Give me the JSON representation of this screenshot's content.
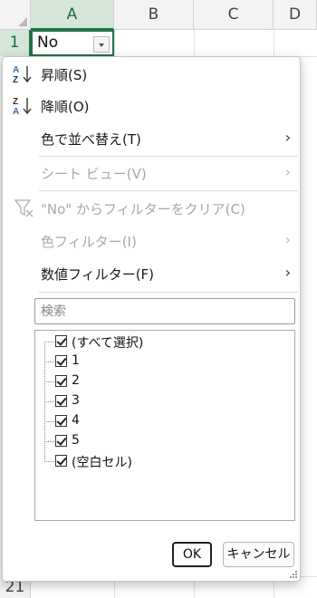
{
  "spreadsheet": {
    "columns": [
      "A",
      "B",
      "C",
      "D"
    ],
    "rows": [
      "1",
      "21"
    ],
    "cell_a1": "No"
  },
  "menu": {
    "sort_asc": "昇順(S)",
    "sort_desc": "降順(O)",
    "sort_by_color": "色で並べ替え(T)",
    "sheet_view": "シート ビュー(V)",
    "clear_filter": "\"No\" からフィルターをクリア(C)",
    "color_filter": "色フィルター(I)",
    "number_filter": "数値フィルター(F)",
    "search_placeholder": "検索",
    "list_items": [
      "(すべて選択)",
      "1",
      "2",
      "3",
      "4",
      "5",
      "(空白セル)"
    ],
    "ok_label": "OK",
    "cancel_label": "キャンセル"
  },
  "colors": {
    "accent": "#217346",
    "selected_header_bg": "#d6e6d9",
    "az_icon_blue": "#2f6fb6"
  },
  "icons": {
    "sort_asc": "sort-ascending-icon",
    "sort_desc": "sort-descending-icon",
    "clear_filter": "clear-filter-icon",
    "submenu": "chevron-right-icon"
  }
}
